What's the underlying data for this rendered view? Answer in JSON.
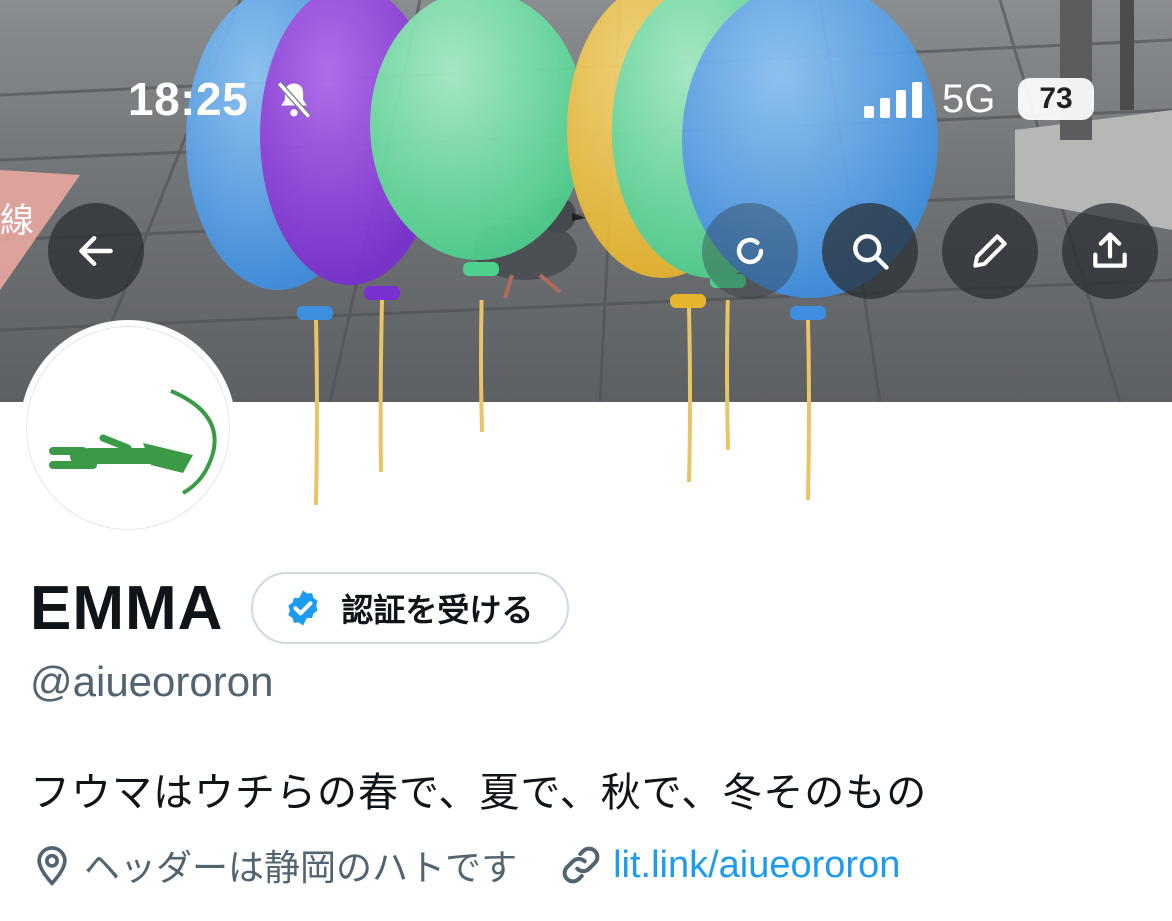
{
  "status_bar": {
    "time": "18:25",
    "network": "5G",
    "battery": "73"
  },
  "header": {
    "banner_sign_text": "線",
    "actions": [
      "back",
      "refresh",
      "search",
      "edit",
      "share"
    ]
  },
  "profile": {
    "display_name": "EMMA",
    "verify_button_label": "認証を受ける",
    "handle": "@aiueororon",
    "bio": "フウマはウチらの春で、夏で、秋で、冬そのもの",
    "location": "ヘッダーは静岡のハトです",
    "link": "lit.link/aiueororon"
  },
  "colors": {
    "accent": "#1d9bf0",
    "avatar_green": "#3a9a45",
    "secondary_text": "#536471"
  }
}
